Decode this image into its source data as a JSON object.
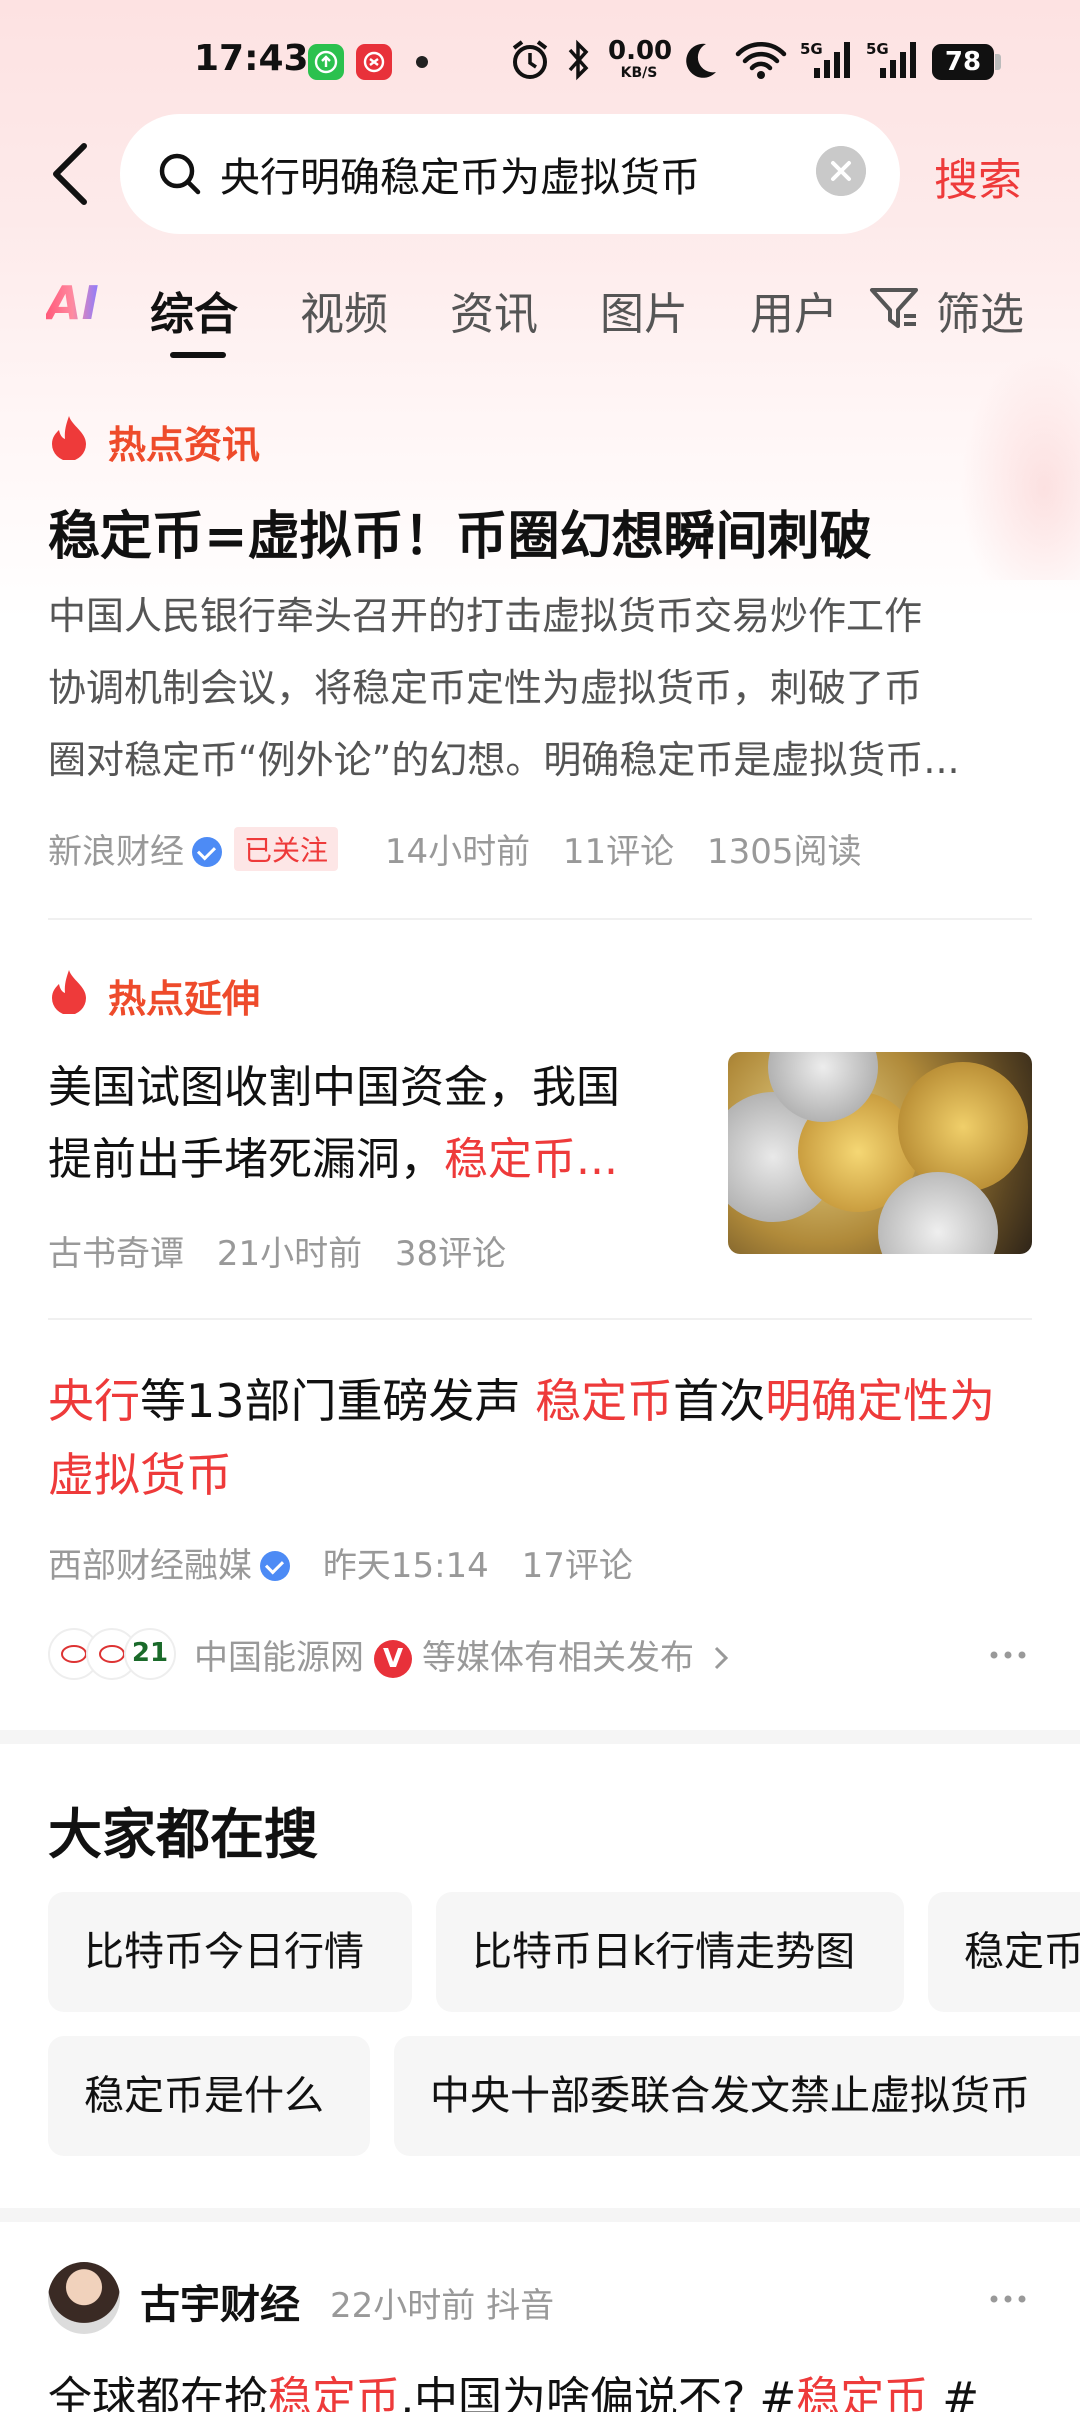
{
  "status_bar": {
    "time": "17:43",
    "net_speed_value": "0.00",
    "net_speed_unit": "KB/S",
    "sim1": "5G",
    "sim2": "5G",
    "battery": "78"
  },
  "search": {
    "query": "央行明确稳定币为虚拟货币",
    "button_label": "搜索"
  },
  "tabs": [
    {
      "label": "AI"
    },
    {
      "label": "综合"
    },
    {
      "label": "视频"
    },
    {
      "label": "资讯"
    },
    {
      "label": "图片"
    },
    {
      "label": "用户"
    },
    {
      "label": "筛选"
    }
  ],
  "hot_news": {
    "section_label": "热点资讯",
    "headline": "稳定币=虚拟币！币圈幻想瞬间刺破",
    "summary_lines": [
      "中国人民银行牵头召开的打击虚拟货币交易炒作工作",
      "协调机制会议，将稳定币定性为虚拟货币，刺破了币",
      "圈对稳定币“例外论”的幻想。明确稳定币是虚拟货币..."
    ],
    "source": "新浪财经",
    "follow_badge": "已关注",
    "time": "14小时前",
    "comments": "11评论",
    "reads": "1305阅读"
  },
  "extension": {
    "section_label": "热点延伸",
    "title_line1": "美国试图收割中国资金，我国",
    "title_line2_plain": "提前出手堵死漏洞，",
    "title_line2_highlight": "稳定币...",
    "source": "古书奇谭",
    "time": "21小时前",
    "comments": "38评论"
  },
  "news3": {
    "seg1_red": "央行",
    "seg2": "等13部门重磅发声 ",
    "seg3_red": "稳定币",
    "seg4": "首次",
    "seg5_red": "明确定性为",
    "line2_red": "虚拟货币",
    "source": "西部财经融媒",
    "time": "昨天15:14",
    "comments": "17评论",
    "related_media": "中国能源网",
    "related_badge": "V",
    "related_suffix": "等媒体有相关发布",
    "avatar3_text": "21"
  },
  "everyone_searching": {
    "title": "大家都在搜",
    "row1": [
      "比特币今日行情",
      "比特币日k行情走势图",
      "稳定币"
    ],
    "row2": [
      "稳定币是什么",
      "中央十部委联合发文禁止虚拟货币"
    ]
  },
  "post": {
    "author": "古宇财经",
    "meta": "22小时前 抖音",
    "text_parts": [
      "全球都在抢",
      "稳定币",
      ",中国为啥偏说不? #",
      "稳定币",
      " #"
    ]
  },
  "colors": {
    "accent_red": "#ee3a3a",
    "label_orange": "#ee4b2b",
    "verified_blue": "#4d8bf5"
  },
  "icons": [
    "back-arrow-icon",
    "search-icon",
    "clear-icon",
    "filter-icon",
    "flame-icon",
    "verified-icon",
    "more-icon",
    "chevron-right-icon",
    "alarm-icon",
    "bluetooth-icon",
    "moon-icon",
    "wifi-icon",
    "signal-icon",
    "battery-icon"
  ]
}
